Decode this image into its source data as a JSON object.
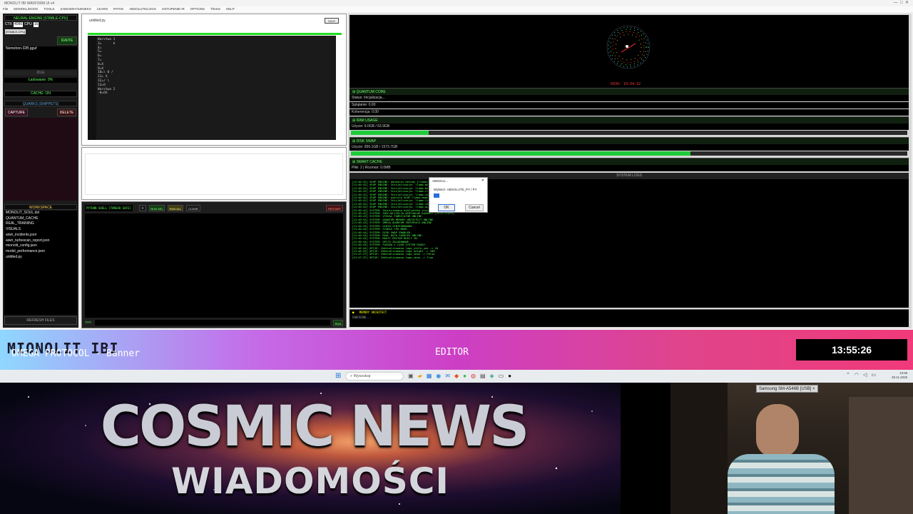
{
  "window": {
    "title": "MONOLIT IBI WAVFORM UI v4",
    "menu": [
      "File",
      "MONOKL/DOOS",
      "TOOLS",
      "ZAWODNY/SZNIEKS",
      "LEARN",
      "PATHS",
      "ABSOLUTE/LOGS",
      "OSTUPENIE IR",
      "OPTIONS",
      "Theme",
      "HELP"
    ]
  },
  "sidebar": {
    "engine_header": "NEURAL ENGINE [STABLE-CPU]",
    "ctx_label": "CTX",
    "ctx_value": "4096",
    "cpu_label": "CPU",
    "cpu_value": "16",
    "stable_badge": "[STABLE-CPU]",
    "ignite": "IGNITE",
    "model": "Nemotron-32B.gguf",
    "idle": "IDLE",
    "loading": "Ładowanie: 0%",
    "cache": "CACHE: ON",
    "quarks_header": "QUARKS (SNIPPETS)",
    "capture": "CAPTURE",
    "delete": "DELETE",
    "workspace_header": "WORKSPACE",
    "files": [
      "MONOLIT_SOUL.dsl",
      "QUANTUM_CACHE",
      "REAL_TRAINING",
      "VISUALS",
      "aiwir_incidents.json",
      "aiwir_turboscan_report.json",
      "mionolit_config.json",
      "model_performance.json",
      "untitled.py"
    ],
    "refresh": "REFRESH FILES"
  },
  "editor": {
    "filename": "untitled.py",
    "save": "SAVE",
    "lines": [
      "Warstwa 1",
      "3=      k",
      "4=",
      "5=",
      "6=",
      "7=",
      "8=X",
      "9=X",
      "10=\\ 0 /",
      "11= X",
      "12=/ \\",
      "13=O",
      "",
      "Warstwa 2",
      "-0=OX"
    ]
  },
  "shell": {
    "label": "PYTHON SHELL [THREAD SAFE]",
    "plus": "+",
    "run_sel": "RUN SEL",
    "run_all": "RUN ALL",
    "clear": "CLEAR",
    "restart": "RESTART",
    "prompt": ">>>",
    "run": "RUN"
  },
  "monitor": {
    "clock": "0930: 10:04:32",
    "quantum": {
      "header": "QUANTUM CORE",
      "status": "Status: Inicjalizacja...",
      "entanglement": "Splątanie: 0.00",
      "coherence": "Koherencja: 0.00"
    },
    "ram": {
      "header": "RAM USAGE",
      "text": "Użycie: 9.0GB / 63.9GB",
      "fraction": 0.14
    },
    "disk": {
      "header": "DISK SWAP",
      "text": "Użycie: 956.1GB / 1573.7GB",
      "fraction": 0.61
    },
    "cache": {
      "header": "SMART CACHE",
      "text": "Pliki: 2 | Rozmiar: 0.0MB"
    }
  },
  "logs": {
    "header": "SYSTEM LOGS",
    "lines": [
      "[13:40:42] SEUP ENGINE: odnosnik metody [llama]",
      "[13:40:42] SEUP ENGINE: Inicjalizacja: llama-mplsdk",
      "[13:40:42] SEUP ENGINE: Inicjalizacja: llama-bench",
      "[13:40:42] SEUP ENGINE: Inicjalizacja: llama-cli.exe",
      "[13:40:42] SEUP ENGINE: Inicjalizacja: llama-compl",
      "[13:40:42] SEUP ENGINE: wykryto GGUF llama-model",
      "[13:40:42] SEUP ENGINE: Inicjalizacja: llama-fit-par",
      "[13:40:42] SEUP ENGINE: Inicjalizacja: llama-imatri",
      "[13:40:42] SEUP ENGINE: Inicjalizacja: llama-quant",
      "[13:40:42] SYSTEM: Zainicjowano biblioteke visualy + Profil",
      "[13:40:42] SYSTEM: INICJALIZACJA WIRTUALNE KAZANIE [Zero-State]",
      "[13:40:43] SYSTEM: VISUAL FABRICATOR ONLINE.",
      "[13:40:43] SYSTEM: QUANTUM MEMORY ARCHITECT ONLINE.",
      "[13:40:43] SYSTEM: OMEGA QUANTUM INTERFACE ONLINE",
      "[13:40:43] SYSTEM: OCHZA ZINTEGROWANA",
      "[13:40:44] SYSTEM: STABLE CPU MODE.",
      "[13:40:44] SYSTEM: DISK SWAP ENABLED.",
      "[13:40:44] SYSTEM: REAL DATA SOURCES ONLINE.",
      "[13:40:44] SYSTEM: MAGIC EDITOR BUILT IN.",
      "[13:46:44] SYSTEM: OPCJE ZALADOWANE.",
      "[13:46:44] SYSTEM: FASADA 1 LOGO SYSTEM READY.",
      "[13:46:44] OPCJE: Zaktualizowano logo_style_use -> 10",
      "[13:46:52] OPCJE: Zaktualizowano logo_height -> 100",
      "[13:47:27] OPCJE: Zaktualizowano logo_show -> False",
      "[13:47:37] OPCJE: Zaktualizowano logo_show -> True"
    ],
    "architect": "MEMORY ARCHITECT",
    "architect_status": "CHECKING..."
  },
  "dialog": {
    "title": "ABSOLU...",
    "prompt": "Wybierz: ABSOLUTE_PY / PY",
    "ok": "OK",
    "cancel": "Cancel"
  },
  "banner": {
    "title": "MIONOLIT IBI",
    "subtitle": "OMEGA PROTOCOL - Banner",
    "center": "EDITOR",
    "time": "13:55:26"
  },
  "taskbar": {
    "search": "Wyszukaj",
    "time": "13:55",
    "date": "28.11.2025"
  },
  "cosmic": {
    "title": "COSMIC NEWS",
    "subtitle": "WIADOMOŚCI"
  },
  "webcam": {
    "label": "Samsung SM-A546B [USB]",
    "close": "×"
  }
}
